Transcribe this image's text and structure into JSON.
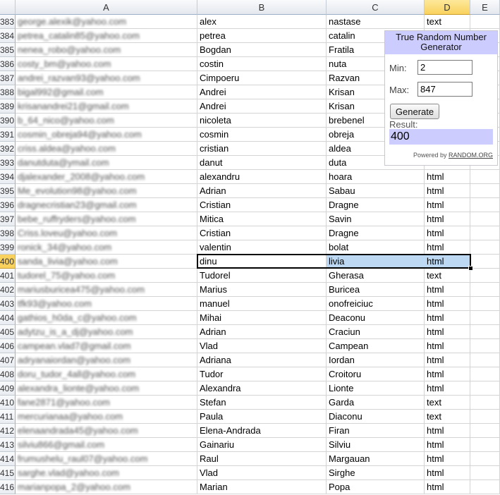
{
  "columns": [
    "A",
    "B",
    "C",
    "D",
    "E"
  ],
  "selected_column": "D",
  "selected_row": "400",
  "rows": [
    {
      "num": "383",
      "a": "george.alexik@yahoo.com",
      "b": "alex",
      "c": "nastase",
      "d": "text"
    },
    {
      "num": "384",
      "a": "petrea_catalin85@yahoo.com",
      "b": "petrea",
      "c": "catalin",
      "d": ""
    },
    {
      "num": "385",
      "a": "nenea_robo@yahoo.com",
      "b": "Bogdan",
      "c": "Fratila",
      "d": ""
    },
    {
      "num": "386",
      "a": "costy_bm@yahoo.com",
      "b": "costin",
      "c": "nuta",
      "d": ""
    },
    {
      "num": "387",
      "a": "andrei_razvan93@yahoo.com",
      "b": "Cimpoeru",
      "c": "Razvan",
      "d": ""
    },
    {
      "num": "388",
      "a": "bigal992@gmail.com",
      "b": "Andrei",
      "c": "Krisan",
      "d": ""
    },
    {
      "num": "389",
      "a": "krisanandrei21@gmail.com",
      "b": "Andrei",
      "c": "Krisan",
      "d": ""
    },
    {
      "num": "390",
      "a": "b_64_nico@yahoo.com",
      "b": "nicoleta",
      "c": "brebenel",
      "d": ""
    },
    {
      "num": "391",
      "a": "cosmin_obreja94@yahoo.com",
      "b": "cosmin",
      "c": "obreja",
      "d": ""
    },
    {
      "num": "392",
      "a": "criss.aldea@yahoo.com",
      "b": "cristian",
      "c": "aldea",
      "d": ""
    },
    {
      "num": "393",
      "a": "danutduta@ymail.com",
      "b": "danut",
      "c": "duta",
      "d": ""
    },
    {
      "num": "394",
      "a": "djalexander_2008@yahoo.com",
      "b": "alexandru",
      "c": "hoara",
      "d": "html"
    },
    {
      "num": "395",
      "a": "Me_evolution98@yahoo.com",
      "b": "Adrian",
      "c": "Sabau",
      "d": "html"
    },
    {
      "num": "396",
      "a": "dragnecristian23@gmail.com",
      "b": "Cristian",
      "c": "Dragne",
      "d": "html"
    },
    {
      "num": "397",
      "a": "bebe_ruffryders@yahoo.com",
      "b": "Mitica",
      "c": "Savin",
      "d": "html"
    },
    {
      "num": "398",
      "a": "Criss.loveu@yahoo.com",
      "b": "Cristian",
      "c": "Dragne",
      "d": "html"
    },
    {
      "num": "399",
      "a": "ronick_34@yahoo.com",
      "b": "valentin",
      "c": "bolat",
      "d": "html"
    },
    {
      "num": "400",
      "a": "sanda_livia@yahoo.com",
      "b": "dinu",
      "c": "livia",
      "d": "html"
    },
    {
      "num": "401",
      "a": "tudorel_75@yahoo.com",
      "b": "Tudorel",
      "c": "Gherasa",
      "d": "text"
    },
    {
      "num": "402",
      "a": "mariusburicea475@yahoo.com",
      "b": "Marius",
      "c": "Buricea",
      "d": "html"
    },
    {
      "num": "403",
      "a": "tfk93@yahoo.com",
      "b": "manuel",
      "c": "onofreiciuc",
      "d": "html"
    },
    {
      "num": "404",
      "a": "gathios_h0da_c@yahoo.com",
      "b": "Mihai",
      "c": "Deaconu",
      "d": "html"
    },
    {
      "num": "405",
      "a": "adytzu_is_a_dj@yahoo.com",
      "b": "Adrian",
      "c": "Craciun",
      "d": "html"
    },
    {
      "num": "406",
      "a": "campean.vlad7@gmail.com",
      "b": "Vlad",
      "c": "Campean",
      "d": "html"
    },
    {
      "num": "407",
      "a": "adryanaiordan@yahoo.com",
      "b": "Adriana",
      "c": "Iordan",
      "d": "html"
    },
    {
      "num": "408",
      "a": "doru_tudor_4all@yahoo.com",
      "b": "Tudor",
      "c": "Croitoru",
      "d": "html"
    },
    {
      "num": "409",
      "a": "alexandra_lionte@yahoo.com",
      "b": "Alexandra",
      "c": "Lionte",
      "d": "html"
    },
    {
      "num": "410",
      "a": "fane2871@yahoo.com",
      "b": "Stefan",
      "c": "Garda",
      "d": "text"
    },
    {
      "num": "411",
      "a": "mercurianaa@yahoo.com",
      "b": "Paula",
      "c": "Diaconu",
      "d": "text"
    },
    {
      "num": "412",
      "a": "elenaandrada45@yahoo.com",
      "b": "Elena-Andrada",
      "c": "Firan",
      "d": "html"
    },
    {
      "num": "413",
      "a": "silviu866@gmail.com",
      "b": "Gainariu",
      "c": "Silviu",
      "d": "html"
    },
    {
      "num": "414",
      "a": "frumushelu_raul07@yahoo.com",
      "b": "Raul",
      "c": "Margauan",
      "d": "html"
    },
    {
      "num": "415",
      "a": "sarghe.vlad@yahoo.com",
      "b": "Vlad",
      "c": "Sirghe",
      "d": "html"
    },
    {
      "num": "416",
      "a": "marianpopa_2@yahoo.com",
      "b": "Marian",
      "c": "Popa",
      "d": "html"
    }
  ],
  "widget": {
    "title": "True Random Number Generator",
    "min_label": "Min:",
    "min_value": "2",
    "max_label": "Max:",
    "max_value": "847",
    "button_label": "Generate",
    "result_label": "Result:",
    "result_value": "400",
    "powered_by": "Powered by",
    "powered_link": "RANDOM.ORG",
    "title_bg": "#ccccff"
  },
  "colors": {
    "selected_header": "#f9d25e",
    "selection_fill": "#bcd8f2",
    "grid": "#d4d4d4"
  }
}
